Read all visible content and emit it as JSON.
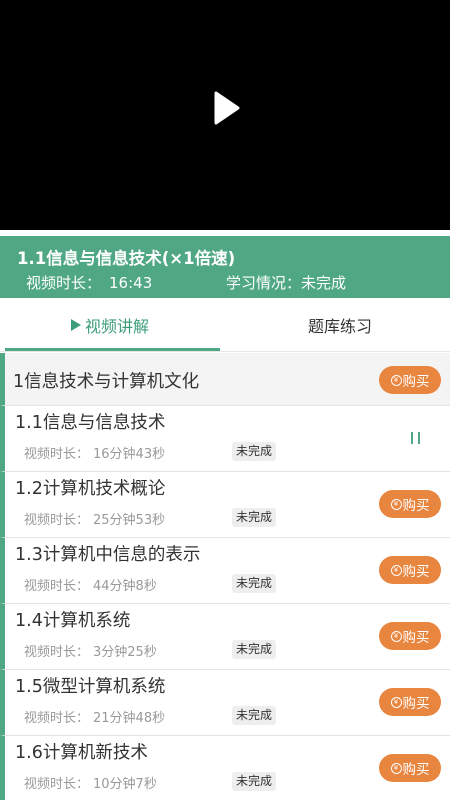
{
  "video": {
    "play_icon": "play-icon"
  },
  "info": {
    "title": "1.1信息与信息技术(×1倍速)",
    "duration_label": "视频时长：",
    "duration_value": "16:43",
    "status_label": "学习情况：",
    "status_value": "未完成"
  },
  "tabs": [
    {
      "label": "视频讲解",
      "active": true
    },
    {
      "label": "题库练习",
      "active": false
    }
  ],
  "chapter": {
    "title": "1信息技术与计算机文化",
    "buy_label": "购买"
  },
  "lessons": [
    {
      "title": "1.1信息与信息技术",
      "duration_label": "视频时长：",
      "duration": "16分钟43秒",
      "status": "未完成",
      "action": "pause"
    },
    {
      "title": "1.2计算机技术概论",
      "duration_label": "视频时长：",
      "duration": "25分钟53秒",
      "status": "未完成",
      "action": "buy",
      "buy_label": "购买"
    },
    {
      "title": "1.3计算机中信息的表示",
      "duration_label": "视频时长：",
      "duration": "44分钟8秒",
      "status": "未完成",
      "action": "buy",
      "buy_label": "购买"
    },
    {
      "title": "1.4计算机系统",
      "duration_label": "视频时长：",
      "duration": "3分钟25秒",
      "status": "未完成",
      "action": "buy",
      "buy_label": "购买"
    },
    {
      "title": "1.5微型计算机系统",
      "duration_label": "视频时长：",
      "duration": "21分钟48秒",
      "status": "未完成",
      "action": "buy",
      "buy_label": "购买"
    },
    {
      "title": "1.6计算机新技术",
      "duration_label": "视频时长：",
      "duration": "10分钟7秒",
      "status": "未完成",
      "action": "buy",
      "buy_label": "购买"
    }
  ],
  "colors": {
    "accent": "#4fa883",
    "buy": "#e8853f"
  },
  "icons": {
    "coin": "¥"
  }
}
